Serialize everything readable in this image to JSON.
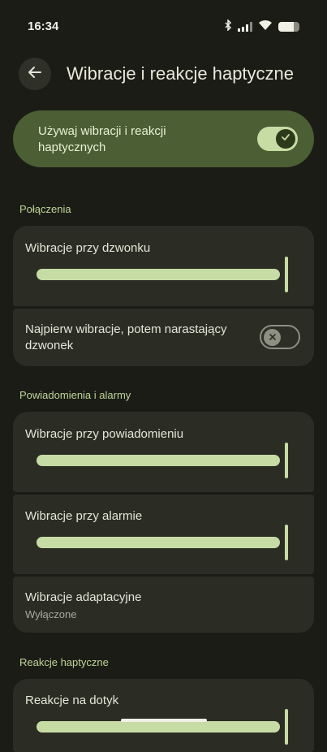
{
  "status": {
    "time": "16:34",
    "battery_level": 0.72
  },
  "header": {
    "title": "Wibracje i reakcje haptyczne"
  },
  "master": {
    "label": "Używaj wibracji i reakcji haptycznych",
    "enabled": true
  },
  "sections": {
    "calls": {
      "header": "Połączenia"
    },
    "notifications": {
      "header": "Powiadomienia i alarmy"
    },
    "haptics": {
      "header": "Reakcje haptyczne"
    }
  },
  "items": {
    "ring_vibration": {
      "label": "Wibracje przy dzwonku",
      "level": 1.0
    },
    "vibrate_first": {
      "label": "Najpierw wibracje, potem narastający dzwonek",
      "enabled": false
    },
    "notification_vibration": {
      "label": "Wibracje przy powiadomieniu",
      "level": 1.0
    },
    "alarm_vibration": {
      "label": "Wibracje przy alarmie",
      "level": 1.0
    },
    "adaptive_vibration": {
      "label": "Wibracje adaptacyjne",
      "summary": "Wyłączone"
    },
    "touch_feedback": {
      "label": "Reakcje na dotyk",
      "level": 1.0
    }
  },
  "colors": {
    "accent": "#c7dba4",
    "background": "#1b1c15",
    "card": "#2b2d24",
    "master": "#4b5e34"
  }
}
